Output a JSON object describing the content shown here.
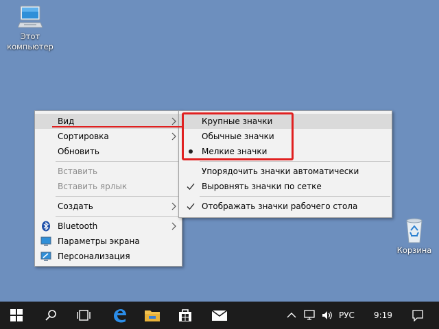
{
  "desktop": {
    "icons": [
      {
        "label_line1": "Этот",
        "label_line2": "компьютер",
        "icon": "computer-icon"
      },
      {
        "label": "Корзина",
        "icon": "recycle-bin-icon"
      }
    ]
  },
  "context_menu": {
    "items": [
      {
        "label": "Вид",
        "has_submenu": true,
        "highlighted": true
      },
      {
        "label": "Сортировка",
        "has_submenu": true
      },
      {
        "label": "Обновить"
      },
      {
        "label": "Вставить",
        "disabled": true
      },
      {
        "label": "Вставить ярлык",
        "disabled": true
      },
      {
        "label": "Создать",
        "has_submenu": true
      },
      {
        "label": "Bluetooth",
        "icon": "bluetooth-icon",
        "has_submenu": true
      },
      {
        "label": "Параметры экрана",
        "icon": "display-settings-icon"
      },
      {
        "label": "Персонализация",
        "icon": "personalization-icon"
      }
    ]
  },
  "view_submenu": {
    "items": [
      {
        "label": "Крупные значки",
        "highlighted": true
      },
      {
        "label": "Обычные значки"
      },
      {
        "label": "Мелкие значки",
        "selected": true,
        "mark": "bullet"
      },
      {
        "label": "Упорядочить значки автоматически"
      },
      {
        "label": "Выровнять значки по сетке",
        "checked": true,
        "mark": "check"
      },
      {
        "label": "Отображать значки рабочего стола",
        "checked": true,
        "mark": "check"
      }
    ]
  },
  "taskbar": {
    "buttons": [
      "start-icon",
      "search-icon",
      "task-view-icon",
      "edge-icon",
      "file-explorer-icon",
      "store-icon",
      "mail-icon"
    ],
    "tray": {
      "language": "РУС",
      "time": "9:19"
    }
  },
  "colors": {
    "desktop_bg": "#6d8fbe",
    "annotation_red": "#e02020",
    "taskbar_bg": "#1c1c1c",
    "menu_bg": "#f2f2f2",
    "menu_highlight": "#dadada"
  }
}
